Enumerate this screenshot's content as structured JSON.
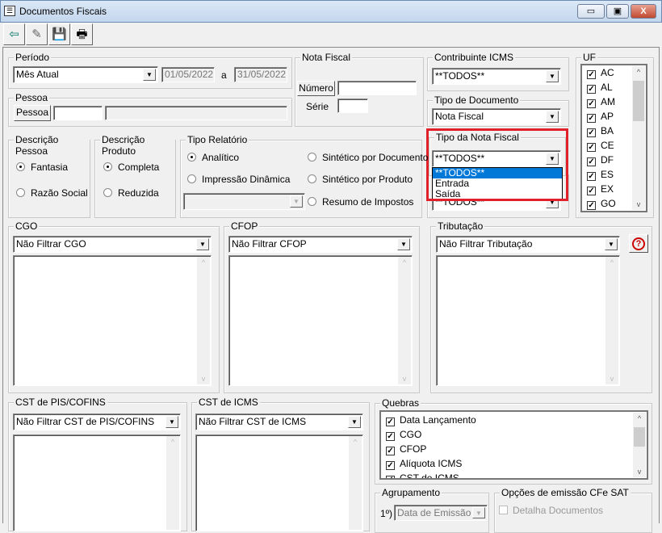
{
  "window": {
    "title": "Documentos Fiscais",
    "minimize": "▭",
    "maximize": "▣",
    "close": "X"
  },
  "toolbar": {
    "exit": "exit-icon",
    "clear": "eraser-icon",
    "save": "save-icon",
    "print": "print-icon"
  },
  "periodo": {
    "label": "Período",
    "value": "Mês Atual",
    "date_from": "01/05/2022",
    "sep": "a",
    "date_to": "31/05/2022"
  },
  "pessoa": {
    "label": "Pessoa",
    "button": "Pessoa",
    "code": "",
    "name": ""
  },
  "nota_fiscal": {
    "label": "Nota Fiscal",
    "numero_button": "Número",
    "numero": "",
    "serie_label": "Série",
    "serie": ""
  },
  "contribuinte": {
    "label": "Contribuinte ICMS",
    "value": "**TODOS**"
  },
  "tipo_documento": {
    "label": "Tipo de Documento",
    "value": "Nota Fiscal"
  },
  "tipo_nota": {
    "label": "Tipo da Nota Fiscal",
    "value": "**TODOS**",
    "options": [
      "**TODOS**",
      "Entrada",
      "Saída"
    ],
    "selected": 0,
    "behind_value": "**TODOS**",
    "highlight_color": "#e0202a"
  },
  "uf": {
    "label": "UF",
    "items": [
      "AC",
      "AL",
      "AM",
      "AP",
      "BA",
      "CE",
      "DF",
      "ES",
      "EX",
      "GO"
    ]
  },
  "desc_pessoa": {
    "label": "Descrição Pessoa",
    "options": [
      "Fantasia",
      "Razão Social"
    ],
    "selected": 0
  },
  "desc_produto": {
    "label": "Descrição Produto",
    "options": [
      "Completa",
      "Reduzida"
    ],
    "selected": 0
  },
  "tipo_relatorio": {
    "label": "Tipo Relatório",
    "options": [
      "Analítico",
      "Impressão Dinâmica",
      "Sintético por Documento",
      "Sintético por Produto",
      "Resumo de Impostos"
    ],
    "selected": 0,
    "combo": ""
  },
  "cgo": {
    "label": "CGO",
    "value": "Não Filtrar CGO"
  },
  "cfop": {
    "label": "CFOP",
    "value": "Não Filtrar CFOP"
  },
  "tributacao": {
    "label": "Tributação",
    "value": "Não Filtrar Tributação",
    "help": "?"
  },
  "cst_pis": {
    "label": "CST de PIS/COFINS",
    "value": "Não Filtrar CST de PIS/COFINS"
  },
  "cst_icms": {
    "label": "CST de ICMS",
    "value": "Não Filtrar CST de ICMS"
  },
  "quebras": {
    "label": "Quebras",
    "items": [
      "Data Lançamento",
      "CGO",
      "CFOP",
      "Alíquota ICMS",
      "CST de ICMS"
    ]
  },
  "agrupamento": {
    "label": "Agrupamento",
    "prefix": "1º)",
    "value": "Data de Emissão"
  },
  "cfe_sat": {
    "label": "Opções de emissão CFe SAT",
    "detalha": "Detalha Documentos",
    "checked": false
  }
}
